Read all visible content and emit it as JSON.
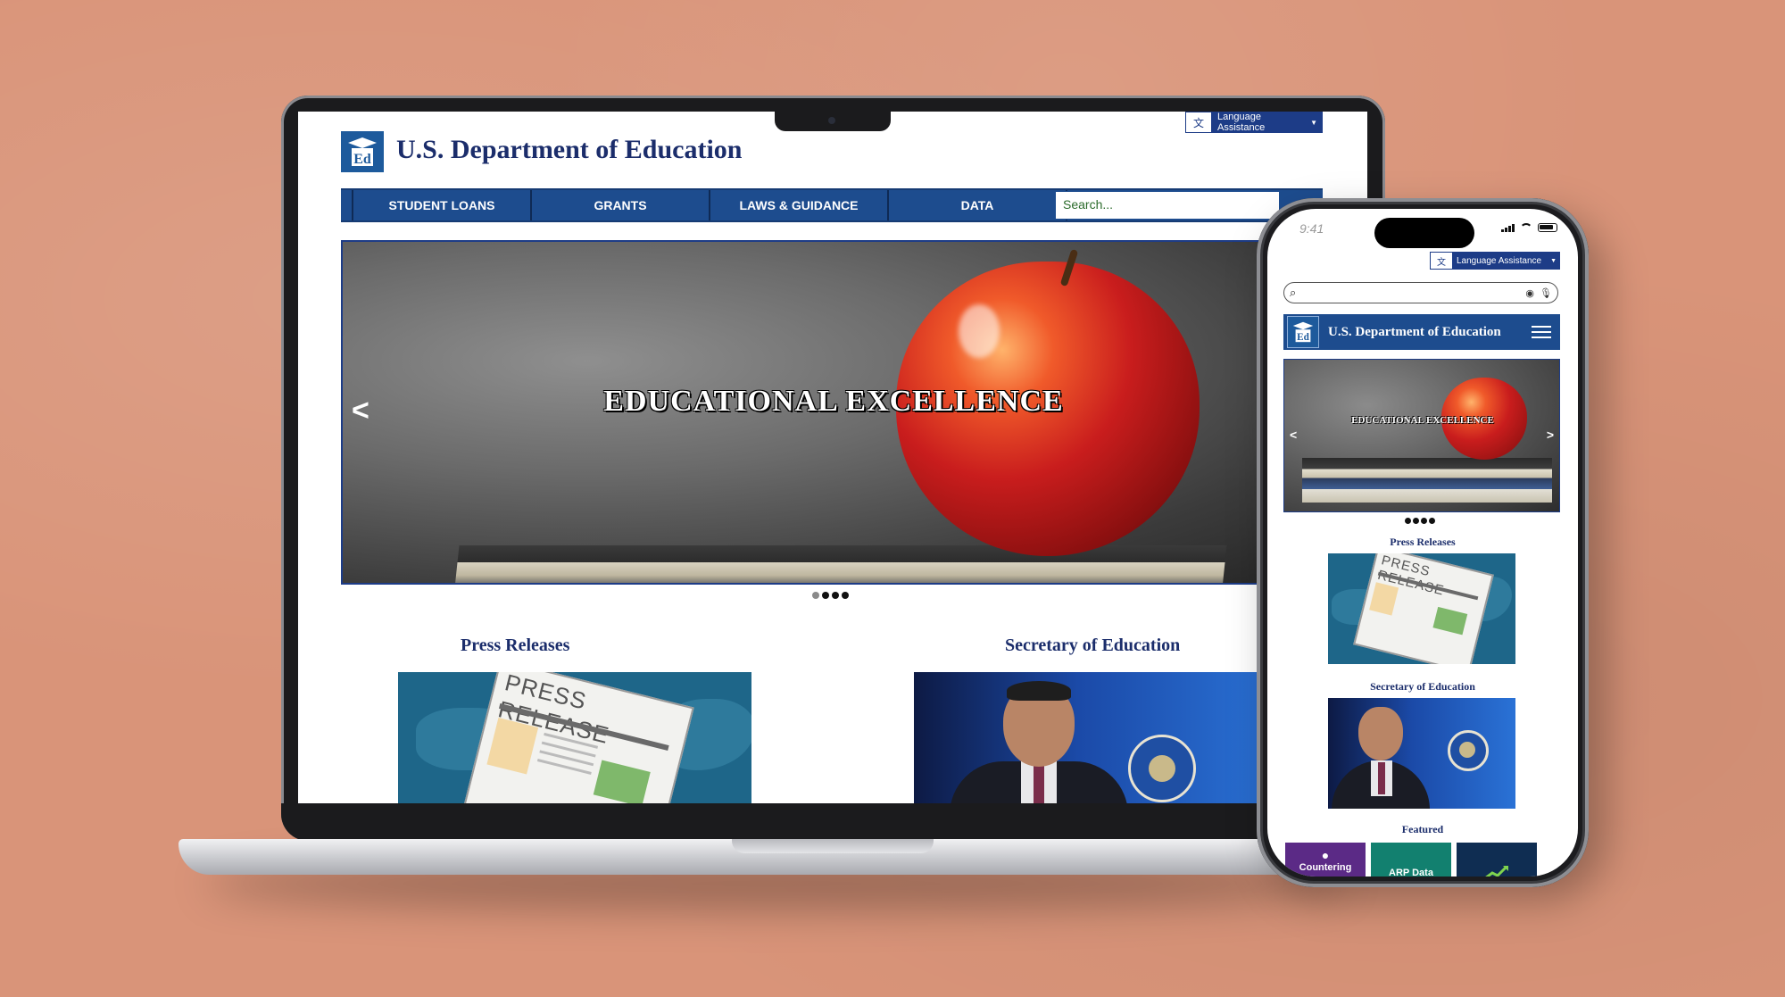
{
  "site": {
    "title": "U.S. Department of Education",
    "logo_text": "Ed",
    "language_label": "Language Assistance",
    "language_icon": "translate-icon",
    "search_placeholder": "Search...",
    "nav": [
      "STUDENT LOANS",
      "GRANTS",
      "LAWS & GUIDANCE",
      "DATA"
    ],
    "hero": {
      "title": "EDUCATIONAL EXCELLENCE",
      "prev": "<",
      "next": ">",
      "slides": 4,
      "active_slide": 1
    },
    "sections": {
      "press": "Press Releases",
      "press_image_text": "PRESS RELEASE",
      "secretary": "Secretary of Education",
      "featured": "Featured"
    }
  },
  "phone": {
    "time": "9:41",
    "featured_items": [
      {
        "label": "Countering",
        "icon": "shield-icon",
        "color": "#5b2a86"
      },
      {
        "label": "ARP Data",
        "icon": "data-icon",
        "color": "#12806f"
      },
      {
        "label": "",
        "icon": "chart-up-icon",
        "color": "#0f2d52"
      }
    ]
  },
  "colors": {
    "brand_blue": "#1d4c8e",
    "title_navy": "#1b2d6b",
    "background": "#d99479"
  }
}
